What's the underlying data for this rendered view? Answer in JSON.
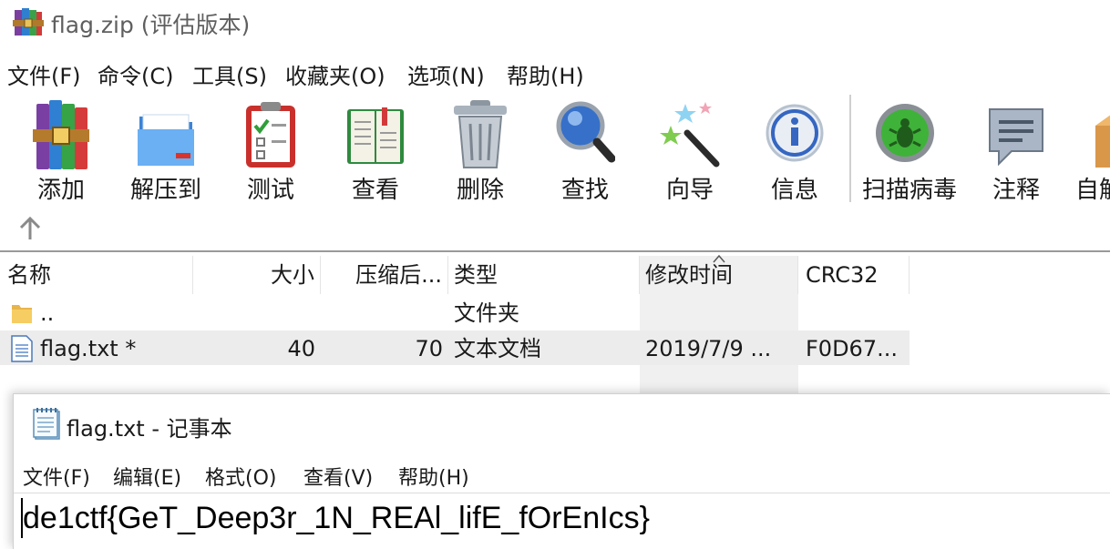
{
  "window": {
    "title": "flag.zip (评估版本)"
  },
  "menubar": [
    "文件(F)",
    "命令(C)",
    "工具(S)",
    "收藏夹(O)",
    "选项(N)",
    "帮助(H)"
  ],
  "toolbar": [
    {
      "label": "添加",
      "icon": "add-archive-icon"
    },
    {
      "label": "解压到",
      "icon": "extract-to-icon"
    },
    {
      "label": "测试",
      "icon": "test-icon"
    },
    {
      "label": "查看",
      "icon": "view-icon"
    },
    {
      "label": "删除",
      "icon": "delete-icon"
    },
    {
      "label": "查找",
      "icon": "find-icon"
    },
    {
      "label": "向导",
      "icon": "wizard-icon"
    },
    {
      "label": "信息",
      "icon": "info-icon"
    },
    {
      "label": "扫描病毒",
      "icon": "virus-scan-icon"
    },
    {
      "label": "注释",
      "icon": "comment-icon"
    },
    {
      "label": "自解",
      "icon": "sfx-icon"
    }
  ],
  "file_list": {
    "columns": [
      "名称",
      "大小",
      "压缩后...",
      "类型",
      "修改时间",
      "CRC32"
    ],
    "rows": [
      {
        "name": "..",
        "size": "",
        "packed": "",
        "type": "文件夹",
        "modified": "",
        "crc": ""
      },
      {
        "name": "flag.txt *",
        "size": "40",
        "packed": "70",
        "type": "文本文档",
        "modified": "2019/7/9 ...",
        "crc": "F0D67..."
      }
    ]
  },
  "notepad": {
    "title": "flag.txt - 记事本",
    "menus": [
      "文件(F)",
      "编辑(E)",
      "格式(O)",
      "查看(V)",
      "帮助(H)"
    ],
    "content": "de1ctf{GeT_Deep3r_1N_REAl_lifE_fOrEnIcs}"
  }
}
